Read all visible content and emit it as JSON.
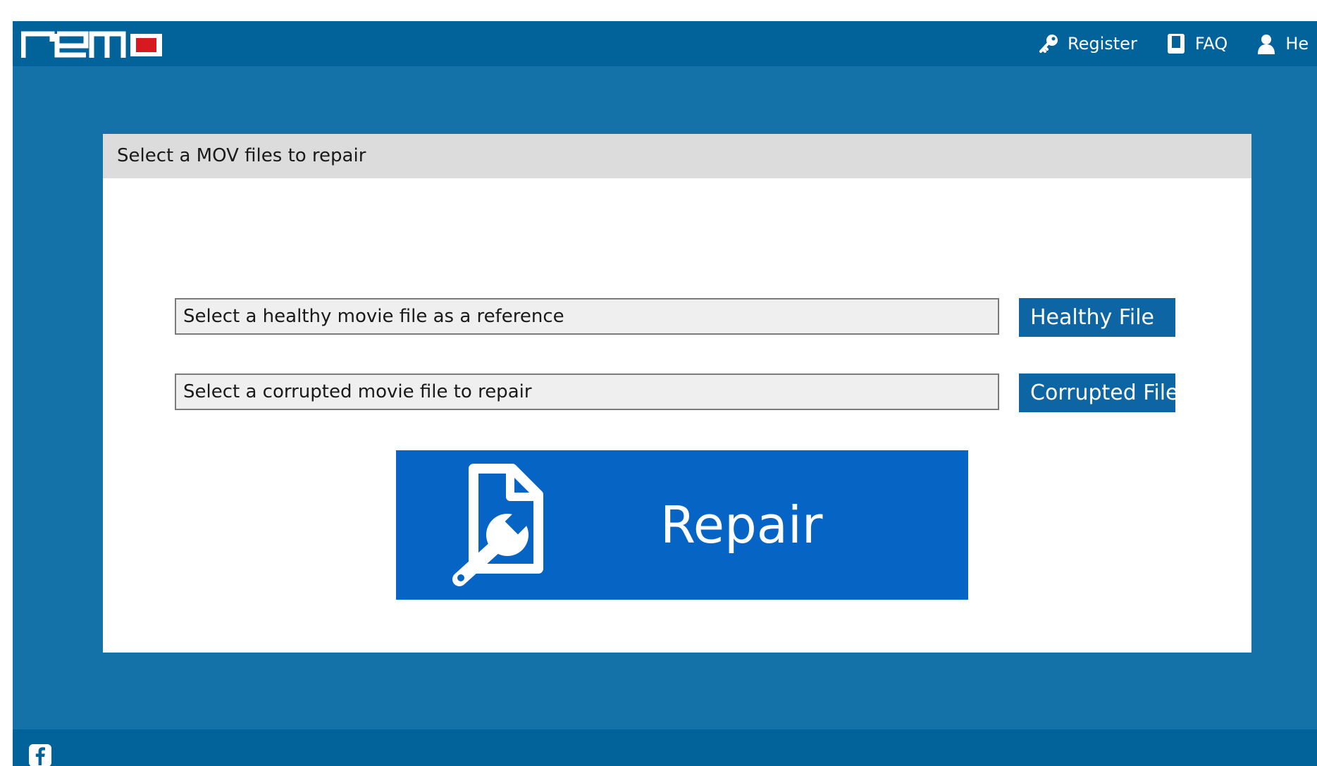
{
  "app": {
    "brand": "remo",
    "colors": {
      "brand_red": "#d71920",
      "topbar": "#02629a",
      "background": "#1572a9",
      "accent_button": "#0664c4"
    }
  },
  "header": {
    "nav": [
      {
        "label": "Register",
        "icon": "key-icon"
      },
      {
        "label": "FAQ",
        "icon": "book-icon"
      },
      {
        "label": "He",
        "icon": "person-icon"
      }
    ]
  },
  "panel": {
    "title": "Select a MOV files to repair",
    "healthy_input_value": "Select a healthy movie file as a reference",
    "healthy_button": "Healthy File",
    "corrupted_input_value": "Select a corrupted movie file to repair",
    "corrupted_button": "Corrupted File",
    "repair_button": {
      "label": "Repair",
      "icon": "file-wrench-icon"
    }
  },
  "footer": {
    "social_icon": "facebook-icon"
  }
}
